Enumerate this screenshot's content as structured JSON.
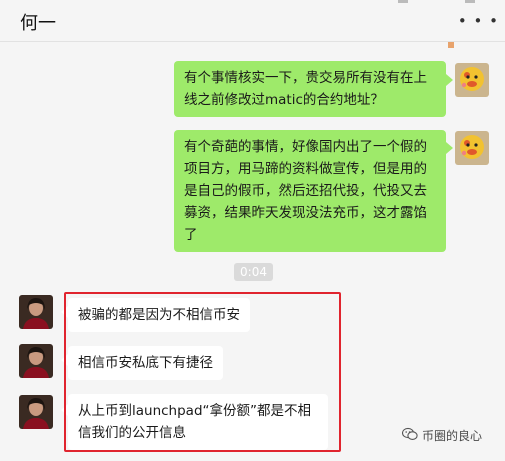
{
  "header": {
    "title": "何一",
    "more_icon": "more-icon"
  },
  "messages": [
    {
      "side": "me",
      "text": "有个事情核实一下，贵交易所有没有在上线之前修改过matic的合约地址？"
    },
    {
      "side": "me",
      "text": "有个奇葩的事情，好像国内出了一个假的项目方，用马蹄的资料做宣传，但是用的是自己的假币，然后还招代投，代投又去募资，结果昨天发现没法充币，这才露馅了"
    },
    {
      "side": "other",
      "text": "被骗的都是因为不相信币安"
    },
    {
      "side": "other",
      "text": "相信币安私底下有捷径"
    },
    {
      "side": "other",
      "text": "从上币到launchpad“拿份额”都是不相信我们的公开信息"
    }
  ],
  "timestamp": "0:04",
  "watermark": {
    "icon": "wechat-icon",
    "text": "币圈的良心"
  },
  "colors": {
    "my_bubble": "#9eea6a",
    "other_bubble": "#ffffff",
    "highlight": "#e0242e"
  }
}
